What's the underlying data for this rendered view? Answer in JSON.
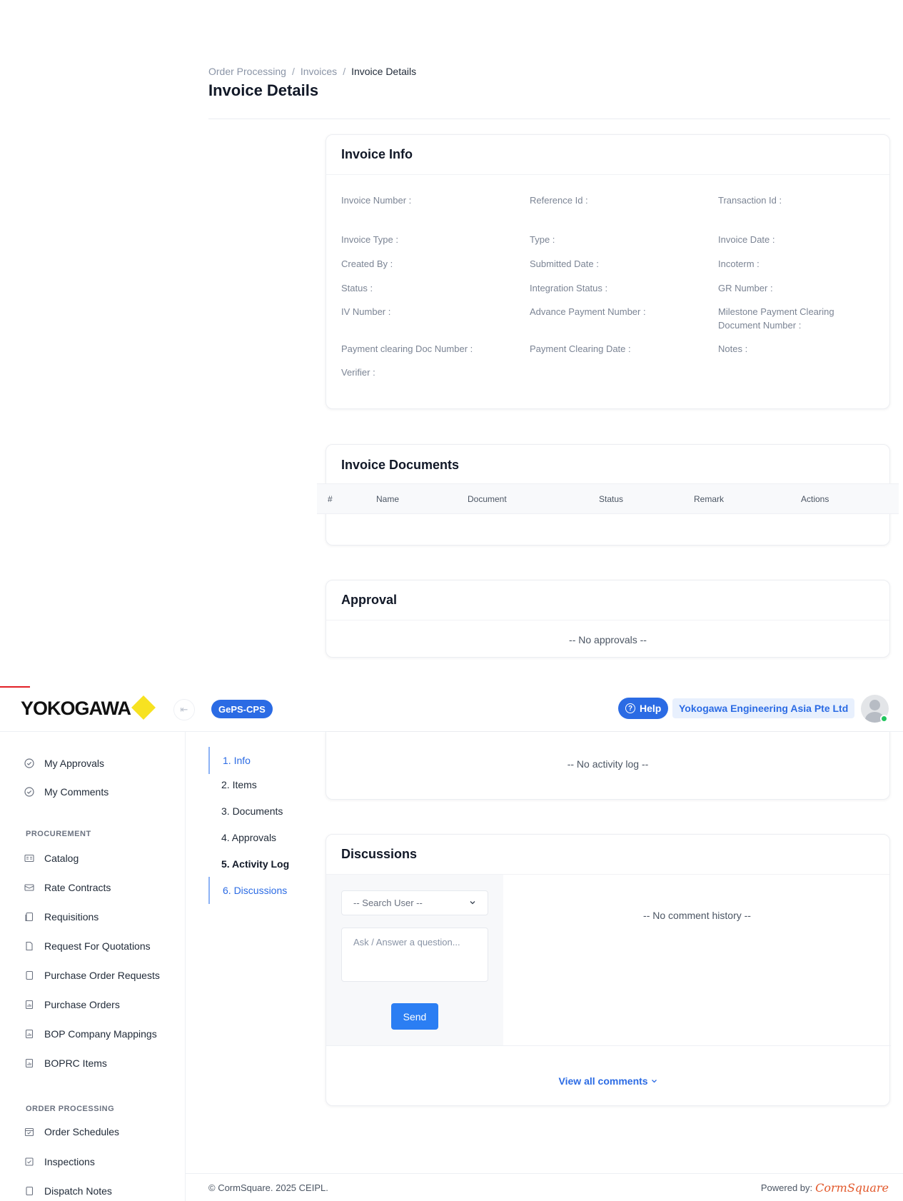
{
  "breadcrumb": [
    "Order Processing",
    "Invoices",
    "Invoice Details"
  ],
  "page_title": "Invoice Details",
  "invoice_info": {
    "title": "Invoice Info",
    "fields": [
      "Invoice Number :",
      "Reference Id :",
      "Transaction Id :",
      "Invoice Type :",
      "Type :",
      "Invoice Date :",
      "Created By :",
      "Submitted Date :",
      "Incoterm :",
      "Status :",
      "Integration Status :",
      "GR Number :",
      "IV Number :",
      "Advance Payment Number :",
      "Milestone Payment Clearing Document Number :",
      "Payment clearing Doc Number :",
      "Payment Clearing Date :",
      "Notes :",
      "Verifier :"
    ]
  },
  "invoice_documents": {
    "title": "Invoice Documents",
    "columns": [
      "#",
      "Name",
      "Document",
      "Status",
      "Remark",
      "Actions"
    ]
  },
  "approval": {
    "title": "Approval",
    "empty": "-- No approvals --"
  },
  "topbar": {
    "brand": "YOKOGAWA",
    "app_badge": "GePS-CPS",
    "help": "Help",
    "company": "Yokogawa Engineering Asia Pte Ltd"
  },
  "sidebar": {
    "top_items": [
      "My Approvals",
      "My Comments"
    ],
    "procurement_label": "PROCUREMENT",
    "procurement_items": [
      "Catalog",
      "Rate Contracts",
      "Requisitions",
      "Request For Quotations",
      "Purchase Order Requests",
      "Purchase Orders",
      "BOP Company Mappings",
      "BOPRC Items"
    ],
    "order_processing_label": "ORDER PROCESSING",
    "order_processing_items": [
      "Order Schedules",
      "Inspections",
      "Dispatch Notes"
    ]
  },
  "steps": [
    "1. Info",
    "2. Items",
    "3. Documents",
    "4. Approvals",
    "5. Activity Log",
    "6. Discussions"
  ],
  "activity_log": {
    "empty": "-- No activity log --"
  },
  "discussions": {
    "title": "Discussions",
    "search_placeholder": "-- Search User --",
    "ask_placeholder": "Ask / Answer a question...",
    "send": "Send",
    "empty": "-- No comment history --",
    "view_all": "View all comments"
  },
  "footer": {
    "copyright": "© CormSquare. 2025 CEIPL.",
    "powered_by": "Powered by:",
    "powered_logo": "CormSquare"
  },
  "colors": {
    "primary": "#2b6be4",
    "brand_yellow": "#f7e221",
    "brand_red": "#e21f26",
    "online": "#22c55e"
  }
}
